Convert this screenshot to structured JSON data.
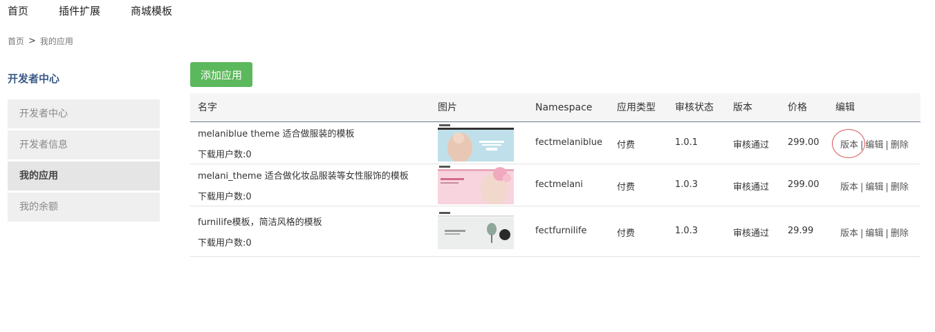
{
  "nav": {
    "items": [
      "首页",
      "插件扩展",
      "商城模板"
    ]
  },
  "breadcrumb": {
    "home": "首页",
    "separator": ">",
    "current": "我的应用"
  },
  "sidebar": {
    "title": "开发者中心",
    "items": [
      {
        "label": "开发者中心",
        "active": false
      },
      {
        "label": "开发者信息",
        "active": false
      },
      {
        "label": "我的应用",
        "active": true
      },
      {
        "label": "我的余额",
        "active": false
      }
    ]
  },
  "actions": {
    "add_app": "添加应用"
  },
  "table": {
    "headers": [
      "名字",
      "图片",
      "Namespace",
      "应用类型",
      "审核状态",
      "版本",
      "价格",
      "编辑"
    ],
    "ops": {
      "version": "版本",
      "edit": "编辑",
      "delete": "删除",
      "separator": "|"
    },
    "rows": [
      {
        "name": "melaniblue theme 适合做服装的模板",
        "downloads": "下载用户数:0",
        "namespace": "fectmelaniblue",
        "type": "付费",
        "version": "1.0.1",
        "status": "审核通过",
        "price": "299.00",
        "thumb": "fashion-theme-thumbnail"
      },
      {
        "name": "melani_theme 适合做化妆品服装等女性服饰的模板",
        "downloads": "下载用户数:0",
        "namespace": "fectmelani",
        "type": "付费",
        "version": "1.0.3",
        "status": "审核通过",
        "price": "299.00",
        "thumb": "cosmetics-theme-thumbnail"
      },
      {
        "name": "furnilife模板，简洁风格的模板",
        "downloads": "下载用户数:0",
        "namespace": "fectfurnilife",
        "type": "付费",
        "version": "1.0.3",
        "status": "审核通过",
        "price": "29.99",
        "thumb": "furniture-theme-thumbnail"
      }
    ]
  },
  "colors": {
    "primary_button": "#5cb85c",
    "sidebar_title": "#3b5a86",
    "annotation_circle": "#d9534f"
  }
}
